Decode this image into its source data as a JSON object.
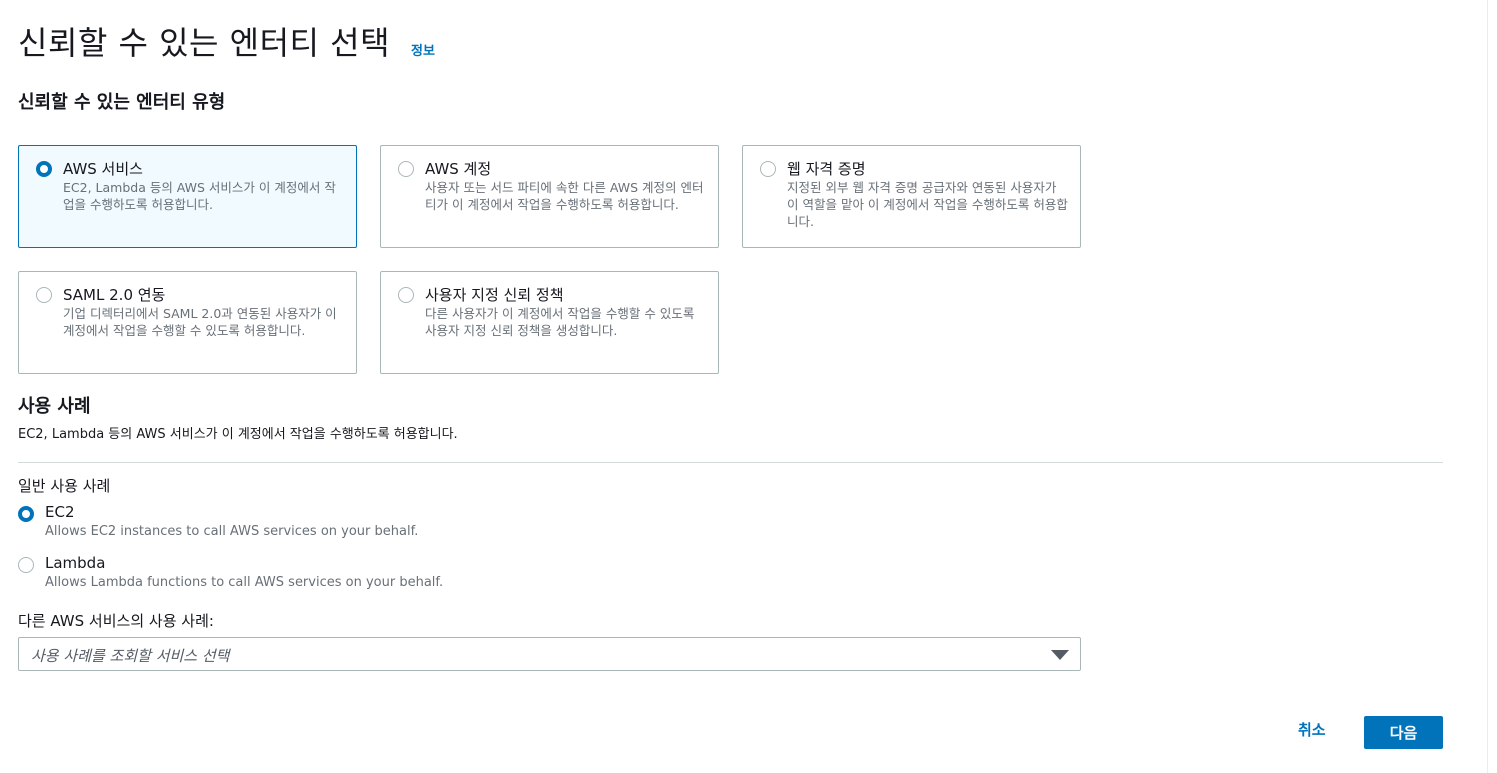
{
  "page": {
    "title": "신뢰할 수 있는 엔터티 선택",
    "info_link": "정보"
  },
  "trusted_entity": {
    "heading": "신뢰할 수 있는 엔터티 유형",
    "options": [
      {
        "title": "AWS 서비스",
        "description": "EC2, Lambda 등의 AWS 서비스가 이 계정에서 작업을 수행하도록 허용합니다.",
        "selected": true
      },
      {
        "title": "AWS 계정",
        "description": "사용자 또는 서드 파티에 속한 다른 AWS 계정의 엔터티가 이 계정에서 작업을 수행하도록 허용합니다.",
        "selected": false
      },
      {
        "title": "웹 자격 증명",
        "description": "지정된 외부 웹 자격 증명 공급자와 연동된 사용자가 이 역할을 맡아 이 계정에서 작업을 수행하도록 허용합니다.",
        "selected": false
      },
      {
        "title": "SAML 2.0 연동",
        "description": "기업 디렉터리에서 SAML 2.0과 연동된 사용자가 이 계정에서 작업을 수행할 수 있도록 허용합니다.",
        "selected": false
      },
      {
        "title": "사용자 지정 신뢰 정책",
        "description": "다른 사용자가 이 계정에서 작업을 수행할 수 있도록 사용자 지정 신뢰 정책을 생성합니다.",
        "selected": false
      }
    ]
  },
  "use_case": {
    "heading": "사용 사례",
    "description": "EC2, Lambda 등의 AWS 서비스가 이 계정에서 작업을 수행하도록 허용합니다.",
    "common_label": "일반 사용 사례",
    "options": [
      {
        "label": "EC2",
        "description": "Allows EC2 instances to call AWS services on your behalf.",
        "selected": true
      },
      {
        "label": "Lambda",
        "description": "Allows Lambda functions to call AWS services on your behalf.",
        "selected": false
      }
    ],
    "other_label": "다른 AWS 서비스의 사용 사례:",
    "select_placeholder": "사용 사례를 조회할 서비스 선택"
  },
  "footer": {
    "cancel_label": "취소",
    "next_label": "다음"
  },
  "colors": {
    "accent": "#0073bb",
    "selected_tile_bg": "#f1faff",
    "muted_text": "#687078"
  }
}
